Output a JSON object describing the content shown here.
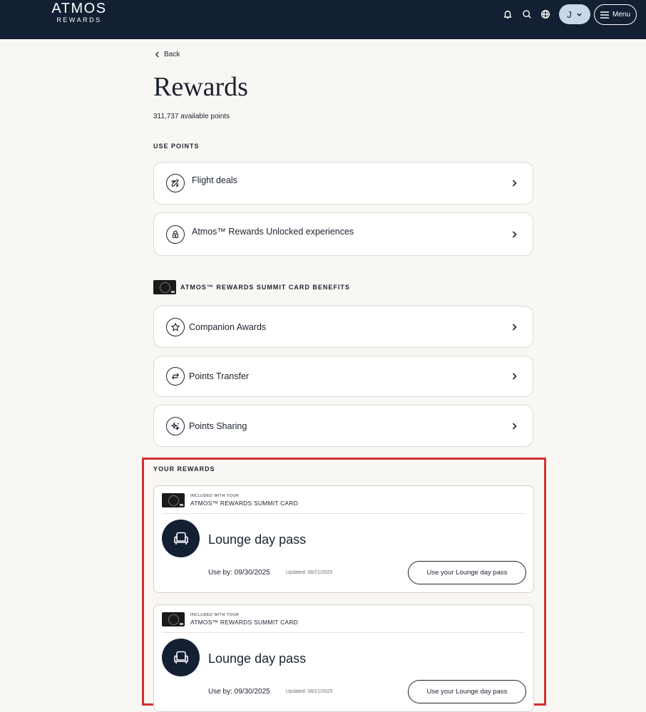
{
  "header": {
    "logo_main": "ATMOS",
    "logo_sub": "REWARDS",
    "avatar_initial": "J",
    "menu_label": "Menu"
  },
  "back_label": "Back",
  "title": "Rewards",
  "points_text": "311,737 available points",
  "use_points": {
    "label": "USE POINTS",
    "items": [
      {
        "label": "Flight deals",
        "icon": "plane-icon"
      },
      {
        "label": "Atmos™ Rewards Unlocked experiences",
        "icon": "lock-icon"
      }
    ]
  },
  "benefits": {
    "label": "ATMOS™ REWARDS SUMMIT CARD BENEFITS",
    "items": [
      {
        "label": "Companion Awards",
        "icon": "star-icon"
      },
      {
        "label": "Points Transfer",
        "icon": "transfer-icon"
      },
      {
        "label": "Points Sharing",
        "icon": "sparkle-icon"
      }
    ]
  },
  "your_rewards": {
    "label": "YOUR REWARDS",
    "items": [
      {
        "included_label": "INCLUDED WITH YOUR",
        "card_name": "ATMOS™ REWARDS SUMMIT CARD",
        "title": "Lounge day pass",
        "use_by": "Use by: 09/30/2025",
        "updated": "Updated: 08/21/2025",
        "button": "Use your Lounge day pass"
      },
      {
        "included_label": "INCLUDED WITH YOUR",
        "card_name": "ATMOS™ REWARDS SUMMIT CARD",
        "title": "Lounge day pass",
        "use_by": "Use by: 09/30/2025",
        "updated": "Updated: 08/21/2025",
        "button": "Use your Lounge day pass"
      }
    ]
  },
  "colors": {
    "header_bg": "#131f32",
    "page_bg": "#f9f7f3",
    "highlight": "#d32f2f",
    "avatar_bg": "#c9d7e8"
  }
}
